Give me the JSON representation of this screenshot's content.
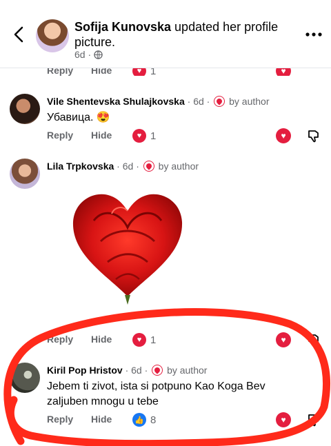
{
  "header": {
    "name": "Sofija Kunovska",
    "action": " updated her profile picture.",
    "time": "6d",
    "privacy_icon": "globe-icon",
    "back_icon": "chevron-left-icon",
    "more_icon": "more-horizontal-icon"
  },
  "partial": {
    "reply": "Reply",
    "hide": "Hide",
    "count": "1"
  },
  "comments": [
    {
      "author": "Vile Shentevska Shulajkovska",
      "time": "6d",
      "badge": "by author",
      "text": "Убавица. 😍",
      "reply": "Reply",
      "hide": "Hide",
      "reaction": "love",
      "count": "1"
    },
    {
      "author": "Lila Trpkovska",
      "time": "6d",
      "badge": "by author",
      "attachment": "red-rose-heart-image",
      "reply": "Reply",
      "hide": "Hide",
      "reaction": "love",
      "count": "1"
    },
    {
      "author": "Kiril Pop Hristov",
      "time": "6d",
      "badge": "by author",
      "text": "Jebem ti zivot, ista si potpuno Kao Koga Bev zaljuben mnogu u tebe",
      "reply": "Reply",
      "hide": "Hide",
      "reaction": "like",
      "count": "8"
    }
  ],
  "colors": {
    "love": "#e41e3f",
    "like": "#1877f2",
    "annotation": "#ff2a1a",
    "secondary_text": "#65676b"
  }
}
